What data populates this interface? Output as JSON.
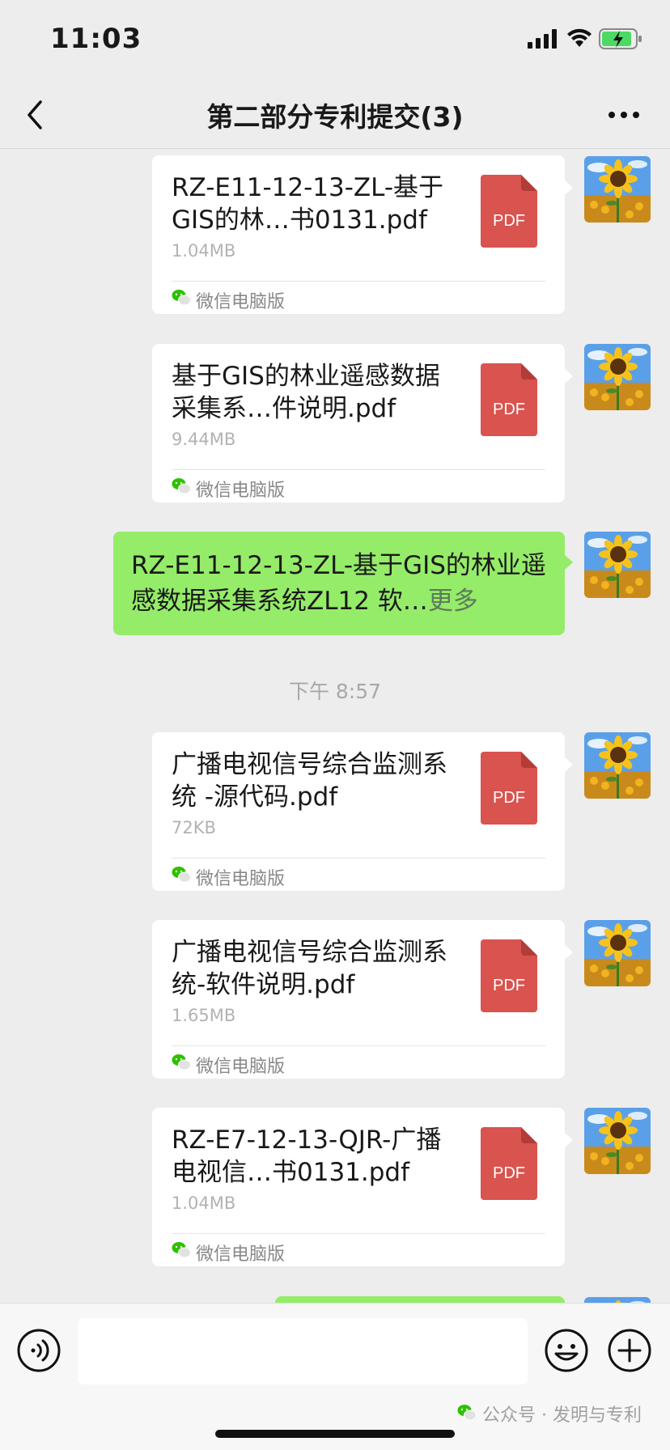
{
  "status_bar": {
    "time": "11:03"
  },
  "nav": {
    "title": "第二部分专利提交(3)"
  },
  "messages": [
    {
      "file_name": "RZ-E11-12-13-ZL-基于GIS的林…书0131.pdf",
      "size": "1.04MB",
      "icon_label": "PDF",
      "source": "微信电脑版"
    },
    {
      "file_name": "基于GIS的林业遥感数据采集系…件说明.pdf",
      "size": "9.44MB",
      "icon_label": "PDF",
      "source": "微信电脑版"
    },
    {
      "text": "RZ-E11-12-13-ZL-基于GIS的林业遥感数据采集系统ZL12 软…",
      "more": "更多"
    },
    {
      "file_name": "广播电视信号综合监测系统 -源代码.pdf",
      "size": "72KB",
      "icon_label": "PDF",
      "source": "微信电脑版"
    },
    {
      "file_name": "广播电视信号综合监测系统-软件说明.pdf",
      "size": "1.65MB",
      "icon_label": "PDF",
      "source": "微信电脑版"
    },
    {
      "file_name": "RZ-E7-12-13-QJR-广播电视信…书0131.pdf",
      "size": "1.04MB",
      "icon_label": "PDF",
      "source": "微信电脑版"
    }
  ],
  "time_separator": "下午 8:57",
  "input": {
    "value": ""
  },
  "watermark": "公众号 · 发明与专利",
  "colors": {
    "bubble_green": "#95ec69",
    "pdf_red": "#d9534f",
    "background": "#ededed"
  }
}
